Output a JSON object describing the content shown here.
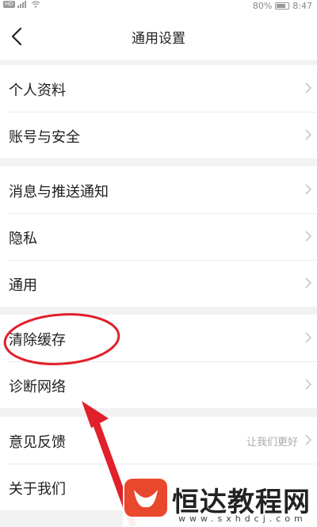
{
  "status_bar": {
    "hd_badge": "HD",
    "battery_percent": "80%",
    "time": "8:47"
  },
  "header": {
    "title": "通用设置",
    "back_icon": "chevron-left-icon"
  },
  "groups": [
    {
      "items": [
        {
          "label": "个人资料"
        },
        {
          "label": "账号与安全"
        }
      ]
    },
    {
      "items": [
        {
          "label": "消息与推送通知"
        },
        {
          "label": "隐私"
        },
        {
          "label": "通用"
        }
      ]
    },
    {
      "items": [
        {
          "label": "清除缓存"
        },
        {
          "label": "诊断网络"
        }
      ]
    },
    {
      "items": [
        {
          "label": "意见反馈",
          "hint": "让我们更好"
        },
        {
          "label": "关于我们"
        }
      ]
    }
  ],
  "annotation": {
    "circle_color": "#e0202a",
    "arrow_color": "#e0202a"
  },
  "watermark": {
    "text": "恒达教程网",
    "url": "www.sxhdcj.com",
    "logo_color": "#e8482c"
  },
  "colors": {
    "background": "#f2f2f2",
    "surface": "#ffffff",
    "chevron": "#c8c8c8"
  }
}
